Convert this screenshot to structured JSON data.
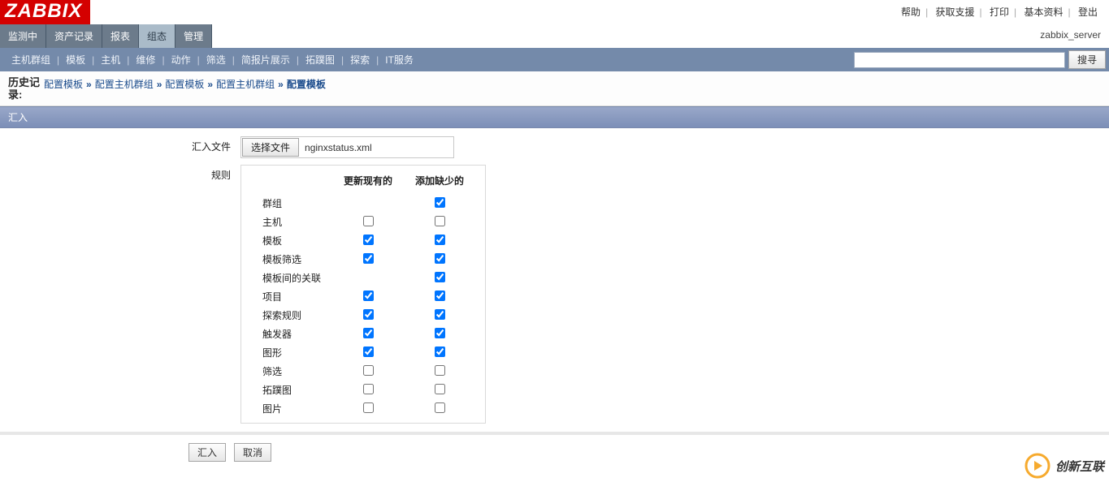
{
  "logo": "ZABBIX",
  "top_links": {
    "help": "帮助",
    "support": "获取支援",
    "print": "打印",
    "profile": "基本资料",
    "login": "登出"
  },
  "server_name": "zabbix_server",
  "nav1": [
    {
      "label": "监测中",
      "active": false
    },
    {
      "label": "资产记录",
      "active": false
    },
    {
      "label": "报表",
      "active": false
    },
    {
      "label": "组态",
      "active": true
    },
    {
      "label": "管理",
      "active": false
    }
  ],
  "nav2": [
    {
      "label": "主机群组"
    },
    {
      "label": "模板"
    },
    {
      "label": "主机"
    },
    {
      "label": "维修"
    },
    {
      "label": "动作"
    },
    {
      "label": "筛选"
    },
    {
      "label": "简报片展示"
    },
    {
      "label": "拓蹼图"
    },
    {
      "label": "探索"
    },
    {
      "label": "IT服务"
    }
  ],
  "search": {
    "placeholder": "",
    "button": "搜寻"
  },
  "history": {
    "label": "历史记录:",
    "items": [
      "配置模板",
      "配置主机群组",
      "配置模板",
      "配置主机群组",
      "配置模板"
    ]
  },
  "section_title": "汇入",
  "form": {
    "file_label": "汇入文件",
    "file_button": "选择文件",
    "file_name": "nginxstatus.xml",
    "rules_label": "规则",
    "col_update": "更新现有的",
    "col_add": "添加缺少的",
    "rows": [
      {
        "label": "群组",
        "update": false,
        "update_enabled": false,
        "add": true
      },
      {
        "label": "主机",
        "update": false,
        "add": false
      },
      {
        "label": "模板",
        "update": true,
        "add": true
      },
      {
        "label": "模板筛选",
        "update": true,
        "add": true
      },
      {
        "label": "模板间的关联",
        "update": false,
        "update_enabled": false,
        "add": true
      },
      {
        "label": "项目",
        "update": true,
        "add": true
      },
      {
        "label": "探索规则",
        "update": true,
        "add": true
      },
      {
        "label": "触发器",
        "update": true,
        "add": true
      },
      {
        "label": "图形",
        "update": true,
        "add": true
      },
      {
        "label": "筛选",
        "update": false,
        "add": false
      },
      {
        "label": "拓蹼图",
        "update": false,
        "add": false
      },
      {
        "label": "图片",
        "update": false,
        "add": false
      }
    ],
    "submit": "汇入",
    "cancel": "取消"
  },
  "watermark": "创新互联"
}
